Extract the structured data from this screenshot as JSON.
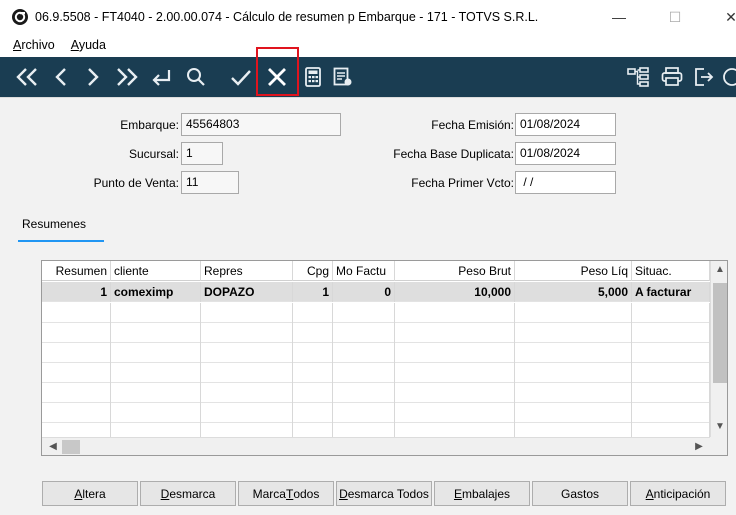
{
  "window": {
    "title": "06.9.5508 - FT4040 - 2.00.00.074 - Cálculo de resumen p Embarque - 171 - TOTVS S.R.L.",
    "min_glyph": "—",
    "max_glyph": "☐",
    "close_glyph": "✕"
  },
  "menu": [
    {
      "key": "A",
      "rest": "rchivo"
    },
    {
      "key": "A",
      "rest": "yuda"
    }
  ],
  "toolbar": {
    "icons": [
      "first-icon",
      "prev-icon",
      "next-icon",
      "last-icon",
      "enter-icon",
      "search-icon",
      "confirm-icon",
      "cancel-icon",
      "calculator-icon",
      "report-icon",
      "tree-icon",
      "print-icon",
      "exit-icon"
    ],
    "highlighted": "cancel-icon",
    "highlight_color": "#e0141e",
    "bg_color": "#1a3d52"
  },
  "form": {
    "embarque_label": "Embarque:",
    "embarque_value": "45564803",
    "sucursal_label": "Sucursal:",
    "sucursal_value": "1",
    "punto_label": "Punto de Venta:",
    "punto_value": "11",
    "fecha_emision_label": "Fecha Emisión:",
    "fecha_emision_value": "01/08/2024",
    "fecha_base_label": "Fecha Base Duplicata:",
    "fecha_base_value": "01/08/2024",
    "fecha_primer_label": "Fecha Primer Vcto:",
    "fecha_primer_value": " / /"
  },
  "tabs": [
    {
      "label": "Resumenes",
      "active": true
    }
  ],
  "grid": {
    "columns": [
      "Resumen",
      "cliente",
      "Repres",
      "Cpg",
      "Mo Factu",
      "Peso Brut",
      "Peso Líq",
      "Situac."
    ],
    "rows": [
      [
        "1",
        "comeximp",
        "DOPAZO",
        "1",
        "0",
        "10,000",
        "5,000",
        "A facturar"
      ]
    ],
    "empty_rows": 8
  },
  "buttons": [
    {
      "pre": "",
      "key": "A",
      "post": "ltera"
    },
    {
      "pre": "",
      "key": "D",
      "post": "esmarca"
    },
    {
      "pre": "Marca ",
      "key": "T",
      "post": "odos"
    },
    {
      "pre": "",
      "key": "D",
      "post": "esmarca Todos"
    },
    {
      "pre": "",
      "key": "E",
      "post": "mbalajes"
    },
    {
      "pre": "",
      "key": "",
      "post": "Gastos"
    },
    {
      "pre": "",
      "key": "A",
      "post": "nticipación"
    }
  ]
}
